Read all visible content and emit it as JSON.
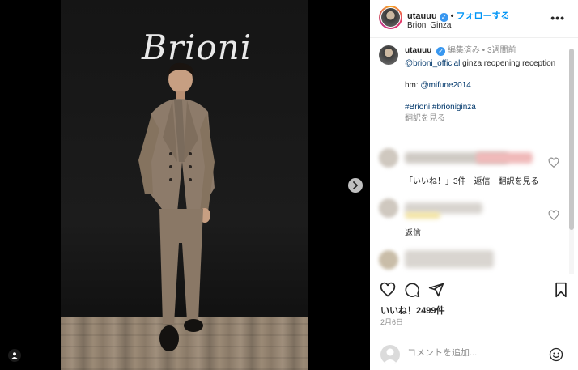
{
  "photo": {
    "logo_text": "Brioni"
  },
  "post": {
    "username": "utauuu",
    "verified_mark": "✓",
    "follow_label": "フォローする",
    "location": "Brioni Ginza",
    "more_label": "•••"
  },
  "caption": {
    "username": "utauuu",
    "edited_label": "編集済み",
    "time_label": "3週間前",
    "mention": "@brioni_official",
    "text": " ginza reopening reception",
    "hm_label": "hm: ",
    "hm_mention": "@mifune2014",
    "hashtags": "#Brioni #brioniginza",
    "translate": "翻訳を見る"
  },
  "comments": [
    {
      "replies_label": "「いいね！」3件",
      "reply": "返信",
      "translate": "翻訳を見る"
    },
    {
      "reply": "返信"
    }
  ],
  "footer": {
    "likes": "いいね！2499件",
    "date": "2月6日",
    "comment_placeholder": "コメントを追加..."
  },
  "colors": {
    "accent": "#0095f6",
    "verified": "#3897f0"
  }
}
